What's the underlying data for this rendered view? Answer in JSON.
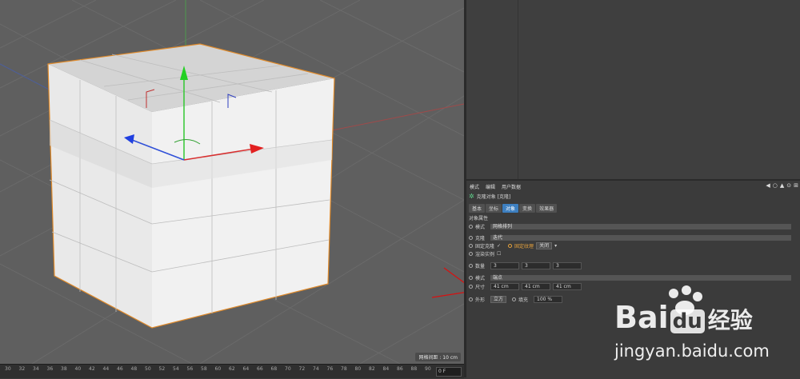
{
  "viewport": {
    "grid_label": "网格间距 : 10 cm"
  },
  "timeline": {
    "ticks": [
      "30",
      "32",
      "34",
      "36",
      "38",
      "40",
      "42",
      "44",
      "46",
      "48",
      "50",
      "52",
      "54",
      "56",
      "58",
      "60",
      "62",
      "64",
      "66",
      "68",
      "70",
      "72",
      "74",
      "76",
      "78",
      "80",
      "82",
      "84",
      "86",
      "88",
      "90"
    ],
    "frame": "0 F"
  },
  "attributes": {
    "menu": [
      "模式",
      "编辑",
      "用户数据"
    ],
    "title": "克隆对象 [克隆]",
    "tabs": [
      "基本",
      "坐标",
      "对象",
      "变换",
      "效果器"
    ],
    "active_tab": "对象",
    "section": "对象属性",
    "mode_label": "模式",
    "mode_value": "网格排列",
    "clone_label": "克隆",
    "clone_value": "迭代",
    "fixed_clone_label": "固定克隆",
    "fixed_clone_check": "✓",
    "fixed_texture_label": "固定纹理",
    "fixed_texture_value": "关闭",
    "render_instance_label": "渲染实例",
    "count_label": "数量",
    "count_values": [
      "3",
      "3",
      "3"
    ],
    "mode2_label": "模式",
    "mode2_value": "端点",
    "size_label": "尺寸",
    "size_values": [
      "41 cm",
      "41 cm",
      "41 cm"
    ],
    "shape_label": "外形",
    "shape_value": "立方",
    "fill_label": "填充",
    "fill_value": "100 %"
  },
  "watermark": {
    "brand": "Bai",
    "brand2": "du",
    "sub": "经验",
    "url": "jingyan.baidu.com"
  }
}
